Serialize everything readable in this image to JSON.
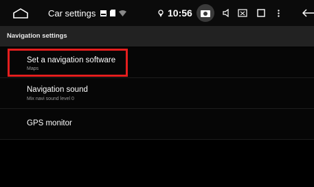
{
  "status_bar": {
    "title": "Car settings",
    "time": "10:56",
    "icons": [
      "home-icon",
      "image-icon",
      "sd-card-icon",
      "wifi-icon",
      "location-icon",
      "camera-icon",
      "volume-icon",
      "screenshot-icon",
      "recents-icon",
      "more-icon",
      "back-icon"
    ]
  },
  "section_header": "Navigation settings",
  "items": [
    {
      "title": "Set a navigation software",
      "subtitle": "Maps",
      "highlighted": true
    },
    {
      "title": "Navigation sound",
      "subtitle": "Mix navi sound level 0",
      "highlighted": false
    },
    {
      "title": "GPS monitor",
      "subtitle": "",
      "highlighted": false
    }
  ],
  "colors": {
    "highlight": "#e41e1e",
    "background": "#000000",
    "header_band": "#222222"
  }
}
